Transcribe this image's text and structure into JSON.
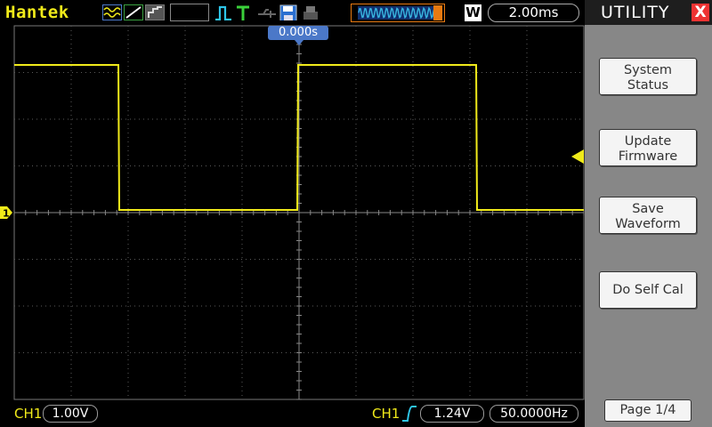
{
  "brand": "Hantek",
  "timebase": "2.00ms",
  "window_mode": "W",
  "trigger_position": "0.000s",
  "channel": {
    "name": "CH1",
    "marker": "1",
    "volts_div": "1.00V",
    "color": "#f0ea1a"
  },
  "trigger": {
    "source": "CH1",
    "edge": "rising",
    "level": "1.24V",
    "frequency": "50.0000Hz"
  },
  "panel": {
    "title": "UTILITY",
    "close": "X",
    "buttons": [
      {
        "label": "System\nStatus"
      },
      {
        "label": "Update\nFirmware"
      },
      {
        "label": "Save\nWaveform"
      },
      {
        "label": "Do Self Cal"
      }
    ],
    "page": "Page 1/4"
  },
  "colors": {
    "trace": "#f0ea1a",
    "grid": "#5a5a5a",
    "panel": "#878787",
    "accent": "#4b78c8"
  }
}
